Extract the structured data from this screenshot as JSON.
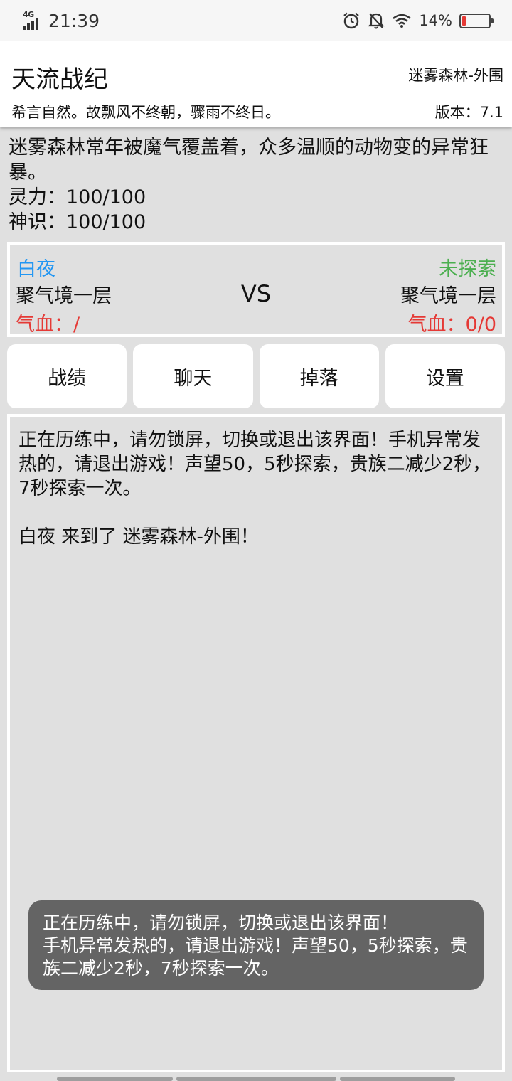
{
  "status_bar": {
    "network": "4G",
    "time": "21:39",
    "battery_percent": "14%",
    "battery_level": 0.14,
    "icons": [
      "alarm-icon",
      "mute-icon",
      "wifi-icon",
      "battery-icon"
    ]
  },
  "header": {
    "title": "天流战纪",
    "location": "迷雾森林-外围",
    "motto": "希言自然。故飘风不终朝，骤雨不终日。",
    "version": "版本：7.1"
  },
  "info": {
    "description": "迷雾森林常年被魔气覆盖着，众多温顺的动物变的异常狂暴。",
    "spirit_label": "灵力：",
    "spirit_value": "100/100",
    "sense_label": "神识：",
    "sense_value": "100/100"
  },
  "battle": {
    "player": {
      "name": "白夜",
      "realm": "聚气境一层",
      "hp_label": "气血：",
      "hp_value": "/"
    },
    "vs": "VS",
    "enemy": {
      "name": "未探索",
      "realm": "聚气境一层",
      "hp_label": "气血：",
      "hp_value": "0/0"
    },
    "colors": {
      "player_name": "#2196f3",
      "enemy_name": "#4caf50",
      "hp": "#e53935"
    }
  },
  "tabs": [
    {
      "label": "战绩"
    },
    {
      "label": "聊天"
    },
    {
      "label": "掉落"
    },
    {
      "label": "设置"
    }
  ],
  "log": {
    "entries": [
      "正在历练中，请勿锁屏，切换或退出该界面！手机异常发热的，请退出游戏！声望50，5秒探索，贵族二减少2秒，7秒探索一次。",
      "白夜 来到了 迷雾森林-外围！"
    ]
  },
  "toast": {
    "line1": "正在历练中，请勿锁屏，切换或退出该界面！",
    "line2": "手机异常发热的，请退出游戏！声望50，5秒探索，贵族二减少2秒，7秒探索一次。"
  }
}
